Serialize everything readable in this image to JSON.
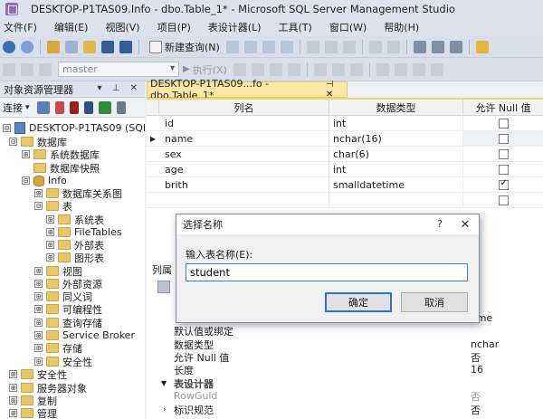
{
  "window": {
    "title": "DESKTOP-P1TAS09.Info - dbo.Table_1* - Microsoft SQL Server Management Studio"
  },
  "menu": [
    "文件(F)",
    "编辑(E)",
    "视图(V)",
    "项目(P)",
    "表设计器(L)",
    "工具(T)",
    "窗口(W)",
    "帮助(H)"
  ],
  "toolbar": {
    "new_query": "新建查询(N)",
    "database": "master",
    "execute": "执行(X)"
  },
  "object_explorer": {
    "title": "对象资源管理器",
    "connect": "连接",
    "tree": [
      {
        "label": "DESKTOP-P1TAS09 (SQL Se",
        "exp": "⊟"
      },
      {
        "label": "数据库",
        "exp": "⊟"
      },
      {
        "label": "系统数据库",
        "exp": "⊞"
      },
      {
        "label": "数据库快照",
        "exp": "⊞"
      },
      {
        "label": "Info",
        "exp": "⊟"
      },
      {
        "label": "数据库关系图",
        "exp": "⊞"
      },
      {
        "label": "表",
        "exp": "⊟"
      },
      {
        "label": "系统表",
        "exp": "⊞"
      },
      {
        "label": "FileTables",
        "exp": "⊞"
      },
      {
        "label": "外部表",
        "exp": "⊞"
      },
      {
        "label": "图形表",
        "exp": "⊞"
      },
      {
        "label": "视图",
        "exp": "⊞"
      },
      {
        "label": "外部资源",
        "exp": "⊞"
      },
      {
        "label": "同义词",
        "exp": "⊞"
      },
      {
        "label": "可编程性",
        "exp": "⊞"
      },
      {
        "label": "查询存储",
        "exp": "⊞"
      },
      {
        "label": "Service Broker",
        "exp": "⊞"
      },
      {
        "label": "存储",
        "exp": "⊞"
      },
      {
        "label": "安全性",
        "exp": "⊞"
      },
      {
        "label": "安全性",
        "exp": "⊞"
      },
      {
        "label": "服务器对象",
        "exp": "⊞"
      },
      {
        "label": "复制",
        "exp": "⊞"
      },
      {
        "label": "管理",
        "exp": "⊞"
      }
    ]
  },
  "document_tab": {
    "label": "DESKTOP-P1TAS09...fo - dbo.Table_1*"
  },
  "grid": {
    "headers": [
      "列名",
      "数据类型",
      "允许 Null 值"
    ],
    "rows": [
      {
        "name": "id",
        "type": "int",
        "null": false
      },
      {
        "name": "name",
        "type": "nchar(16)",
        "null": false
      },
      {
        "name": "sex",
        "type": "char(6)",
        "null": false
      },
      {
        "name": "age",
        "type": "int",
        "null": false
      },
      {
        "name": "brith",
        "type": "smalldatetime",
        "null": true
      },
      {
        "name": "",
        "type": "",
        "null": false
      }
    ]
  },
  "properties": {
    "tab": "列属",
    "rows": [
      {
        "name": "",
        "value": "ame"
      },
      {
        "name": "默认值或绑定",
        "value": ""
      },
      {
        "name": "数据类型",
        "value": "nchar"
      },
      {
        "name": "允许 Null 值",
        "value": "否"
      },
      {
        "name": "长度",
        "value": "16"
      },
      {
        "name": "表设计器",
        "value": ""
      },
      {
        "name": "RowGuid",
        "value": "否"
      },
      {
        "name": "标识规范",
        "value": "否"
      }
    ]
  },
  "dialog": {
    "title": "选择名称",
    "help": "?",
    "close": "✕",
    "label": "输入表名称(E):",
    "value": "student",
    "ok": "确定",
    "cancel": "取消"
  }
}
